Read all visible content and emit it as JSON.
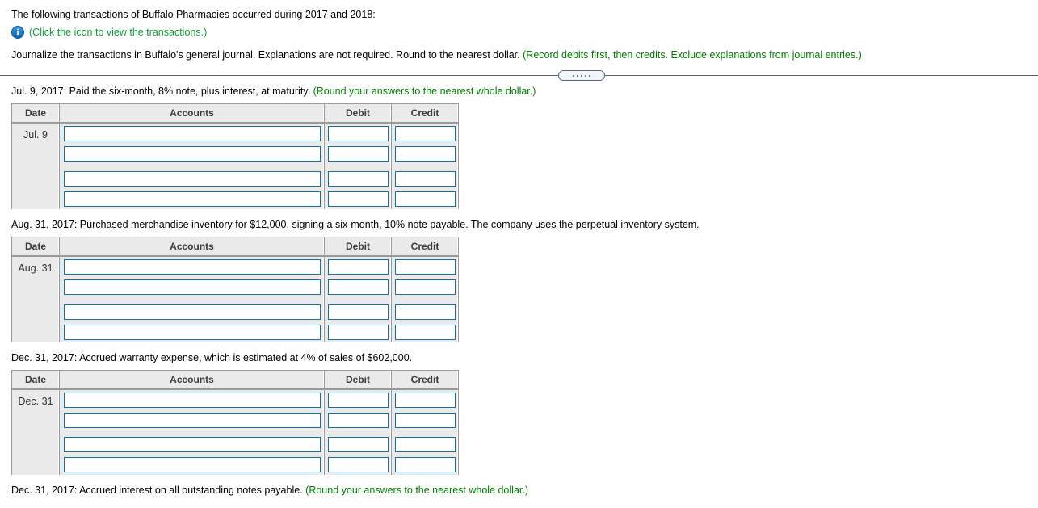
{
  "header": {
    "intro": "The following transactions of Buffalo Pharmacies occurred during 2017 and 2018:",
    "icon_link": "(Click the icon to view the transactions.)",
    "icon_name": "info-icon",
    "instruction_black": "Journalize the transactions in Buffalo's general journal. Explanations are not required. Round to the nearest dollar.",
    "instruction_green": "(Record debits first, then credits. Exclude explanations from journal entries.)"
  },
  "splitter": {
    "dots": 5
  },
  "columns": {
    "date": "Date",
    "accounts": "Accounts",
    "debit": "Debit",
    "credit": "Credit"
  },
  "sections": [
    {
      "text_black": "Jul. 9, 2017: Paid the six-month, 8% note, plus interest, at maturity.",
      "text_green": "(Round your answers to the nearest whole dollar.)",
      "date_label": "Jul. 9",
      "rows": [
        {
          "account": "",
          "debit": "",
          "credit": ""
        },
        {
          "account": "",
          "debit": "",
          "credit": ""
        },
        {
          "account": "",
          "debit": "",
          "credit": ""
        },
        {
          "account": "",
          "debit": "",
          "credit": ""
        }
      ]
    },
    {
      "text_black": "Aug. 31, 2017: Purchased merchandise inventory for $12,000, signing a six-month, 10% note payable. The company uses the perpetual inventory system.",
      "text_green": "",
      "date_label": "Aug. 31",
      "rows": [
        {
          "account": "",
          "debit": "",
          "credit": ""
        },
        {
          "account": "",
          "debit": "",
          "credit": ""
        },
        {
          "account": "",
          "debit": "",
          "credit": ""
        },
        {
          "account": "",
          "debit": "",
          "credit": ""
        }
      ]
    },
    {
      "text_black": "Dec. 31, 2017: Accrued warranty expense, which is estimated at 4% of sales of $602,000.",
      "text_green": "",
      "date_label": "Dec. 31",
      "rows": [
        {
          "account": "",
          "debit": "",
          "credit": ""
        },
        {
          "account": "",
          "debit": "",
          "credit": ""
        },
        {
          "account": "",
          "debit": "",
          "credit": ""
        },
        {
          "account": "",
          "debit": "",
          "credit": ""
        }
      ]
    }
  ],
  "footer": {
    "text_black": "Dec. 31, 2017: Accrued interest on all outstanding notes payable.",
    "text_green": "(Round your answers to the nearest whole dollar.)"
  },
  "colors": {
    "green_text": "#008000",
    "link_green": "#0f9b38",
    "input_border": "#1273a0",
    "table_bg": "#eaeaea",
    "splitter": "#5b6472"
  }
}
